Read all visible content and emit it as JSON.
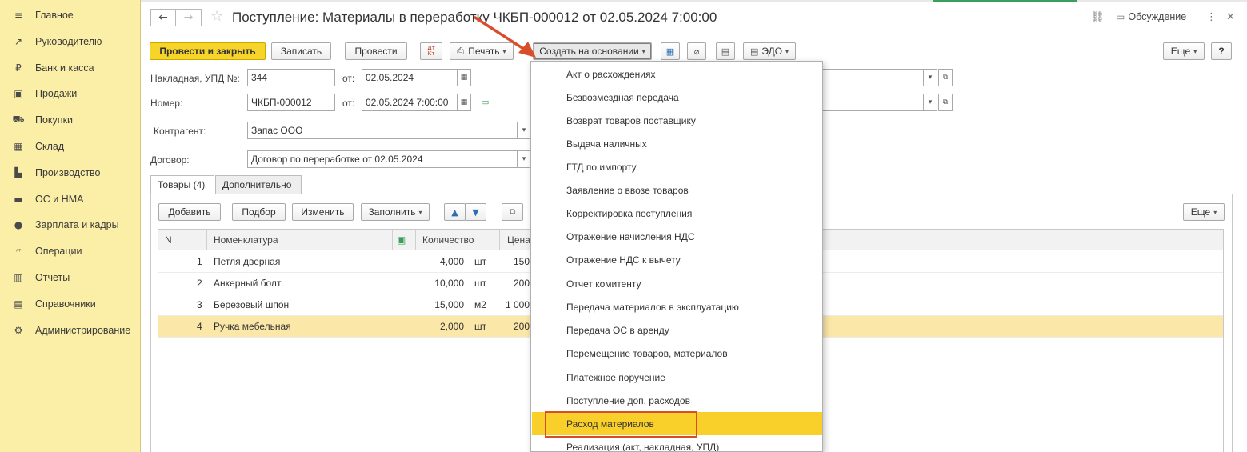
{
  "sidebar": {
    "items": [
      {
        "label": "Главное",
        "icon": "≡"
      },
      {
        "label": "Руководителю",
        "icon": "↗"
      },
      {
        "label": "Банк и касса",
        "icon": "₽"
      },
      {
        "label": "Продажи",
        "icon": "▣"
      },
      {
        "label": "Покупки",
        "icon": "⛟"
      },
      {
        "label": "Склад",
        "icon": "▦"
      },
      {
        "label": "Производство",
        "icon": "▙"
      },
      {
        "label": "ОС и НМА",
        "icon": "▬"
      },
      {
        "label": "Зарплата и кадры",
        "icon": "●"
      },
      {
        "label": "Операции",
        "icon": "ᴬᵀ"
      },
      {
        "label": "Отчеты",
        "icon": "▥"
      },
      {
        "label": "Справочники",
        "icon": "▤"
      },
      {
        "label": "Администрирование",
        "icon": "⚙"
      }
    ]
  },
  "header": {
    "title": "Поступление: Материалы в переработку ЧКБП-000012 от 02.05.2024 7:00:00",
    "discussion": "Обсуждение",
    "back_icon": "←",
    "forward_icon": "→",
    "star_icon": "☆",
    "link_icon": "⛓",
    "more_icon": "⋮",
    "close_icon": "✕"
  },
  "toolbar": {
    "post_close": "Провести и закрыть",
    "save": "Записать",
    "post": "Провести",
    "dtkt": "Дт Кт",
    "print": "Печать",
    "create_basis": "Создать на основании",
    "edo": "ЭДО",
    "more": "Еще",
    "help": "?"
  },
  "form": {
    "invoice_label": "Накладная, УПД №:",
    "invoice_value": "344",
    "from_label": "от:",
    "invoice_date": "02.05.2024",
    "number_label": "Номер:",
    "number_value": "ЧКБП-000012",
    "number_from_label": "от:",
    "number_date": "02.05.2024  7:00:00",
    "counterparty_label": "Контрагент:",
    "counterparty_value": "Запас ООО",
    "contract_label": "Договор:",
    "contract_value": "Договор по переработке от 02.05.2024"
  },
  "tabs": [
    {
      "label": "Товары (4)"
    },
    {
      "label": "Дополнительно"
    }
  ],
  "table_toolbar": {
    "add": "Добавить",
    "pick": "Подбор",
    "change": "Изменить",
    "fill": "Заполнить",
    "more": "Еще"
  },
  "table": {
    "columns": [
      "N",
      "Номенклатура",
      "",
      "Количество",
      "Цена"
    ],
    "rows": [
      {
        "n": "1",
        "name": "Петля дверная",
        "qty": "4,000",
        "unit": "шт",
        "price": "150"
      },
      {
        "n": "2",
        "name": "Анкерный болт",
        "qty": "10,000",
        "unit": "шт",
        "price": "200"
      },
      {
        "n": "3",
        "name": "Березовый шпон",
        "qty": "15,000",
        "unit": "м2",
        "price": "1 000"
      },
      {
        "n": "4",
        "name": "Ручка мебельная",
        "qty": "2,000",
        "unit": "шт",
        "price": "200"
      }
    ]
  },
  "menu": {
    "items": [
      "Акт о расхождениях",
      "Безвозмездная передача",
      "Возврат товаров поставщику",
      "Выдача наличных",
      "ГТД по импорту",
      "Заявление о ввозе товаров",
      "Корректировка поступления",
      "Отражение начисления НДС",
      "Отражение НДС к вычету",
      "Отчет комитенту",
      "Передача материалов в эксплуатацию",
      "Передача ОС в аренду",
      "Перемещение товаров, материалов",
      "Платежное поручение",
      "Поступление доп. расходов",
      "Расход материалов",
      "Реализация (акт, накладная, УПД)"
    ],
    "highlighted_index": 15
  },
  "colors": {
    "sidebar_bg": "#fbeea6",
    "primary_button": "#f7d42a",
    "menu_highlight": "#f9cf2a",
    "annotation_red": "#d94e2a",
    "selected_row": "#fbe7a8"
  }
}
